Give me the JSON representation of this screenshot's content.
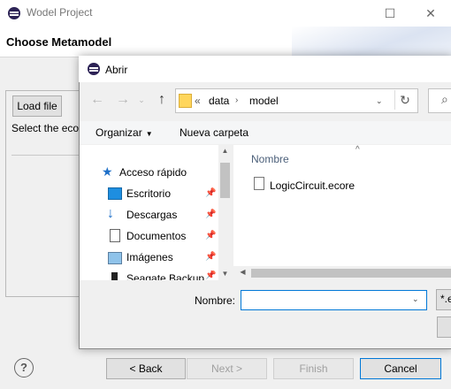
{
  "wizard": {
    "title": "Wodel Project",
    "header_title": "Choose Metamodel",
    "load_file_label": "Load file",
    "select_text": "Select the ecor",
    "buttons": {
      "back": "< Back",
      "next": "Next >",
      "finish": "Finish",
      "cancel": "Cancel"
    },
    "help_glyph": "?"
  },
  "dialog": {
    "title": "Abrir",
    "breadcrumb": {
      "prefix": "«",
      "items": [
        "data",
        "model"
      ]
    },
    "toolbar": {
      "organize": "Organizar",
      "new_folder": "Nueva carpeta"
    },
    "nav_items": [
      {
        "label": "Acceso rápido",
        "icon": "star-icon"
      },
      {
        "label": "Escritorio",
        "icon": "desktop-icon"
      },
      {
        "label": "Descargas",
        "icon": "download-icon"
      },
      {
        "label": "Documentos",
        "icon": "documents-icon"
      },
      {
        "label": "Imágenes",
        "icon": "pictures-icon"
      },
      {
        "label": "Seagate Backup",
        "icon": "drive-icon"
      }
    ],
    "column_header": "Nombre",
    "files": [
      "LogicCircuit.ecore"
    ],
    "filename_label": "Nombre:",
    "filename_value": "",
    "filter_label": "*.e"
  }
}
